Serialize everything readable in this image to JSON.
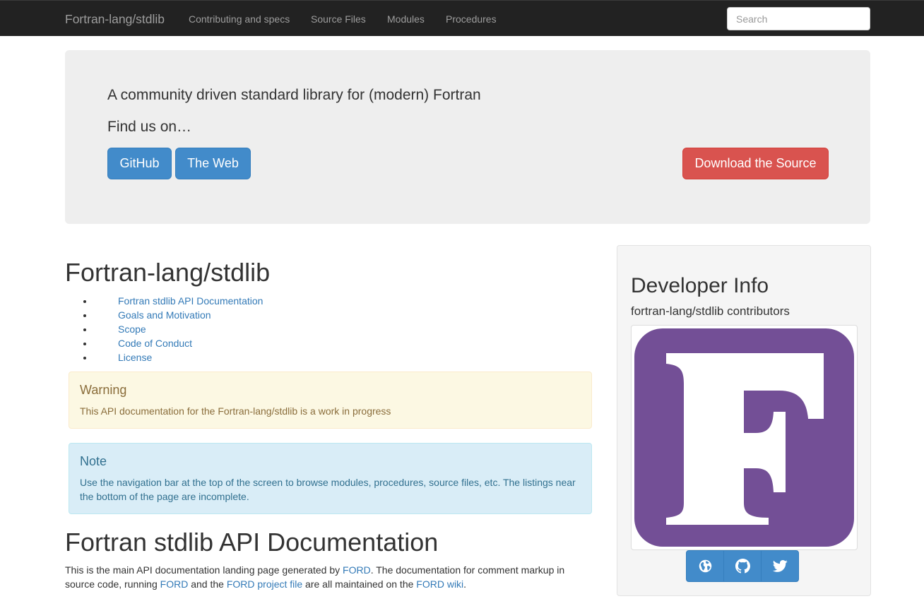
{
  "navbar": {
    "brand": "Fortran-lang/stdlib",
    "links": [
      "Contributing and specs",
      "Source Files",
      "Modules",
      "Procedures"
    ],
    "search_placeholder": "Search"
  },
  "jumbotron": {
    "tagline": "A community driven standard library for (modern) Fortran",
    "find_us": "Find us on…",
    "buttons": {
      "github": "GitHub",
      "web": "The Web",
      "download": "Download the Source"
    }
  },
  "main": {
    "title": "Fortran-lang/stdlib",
    "toc": [
      "Fortran stdlib API Documentation",
      "Goals and Motivation",
      "Scope",
      "Code of Conduct",
      "License"
    ],
    "warning": {
      "heading": "Warning",
      "text": "This API documentation for the Fortran-lang/stdlib is a work in progress"
    },
    "note": {
      "heading": "Note",
      "text": "Use the navigation bar at the top of the screen to browse modules, procedures, source files, etc. The listings near the bottom of the page are incomplete."
    },
    "api": {
      "title": "Fortran stdlib API Documentation",
      "p1": "This is the main API documentation landing page generated by ",
      "link_ford": "FORD",
      "p2": ". The documentation for comment markup in source code, running ",
      "link_ford2": "FORD",
      "p3": " and the ",
      "link_project": "FORD project file",
      "p4": " are all maintained on the ",
      "link_wiki": "FORD wiki",
      "p5": "."
    }
  },
  "sidebar": {
    "title": "Developer Info",
    "subtitle": "fortran-lang/stdlib contributors",
    "logo_color": "#734f96",
    "icons": [
      "globe-icon",
      "github-icon",
      "twitter-icon"
    ]
  },
  "colors": {
    "navbar_bg": "#222222",
    "primary": "#428bca",
    "danger": "#d9534f",
    "link": "#337ab7"
  }
}
